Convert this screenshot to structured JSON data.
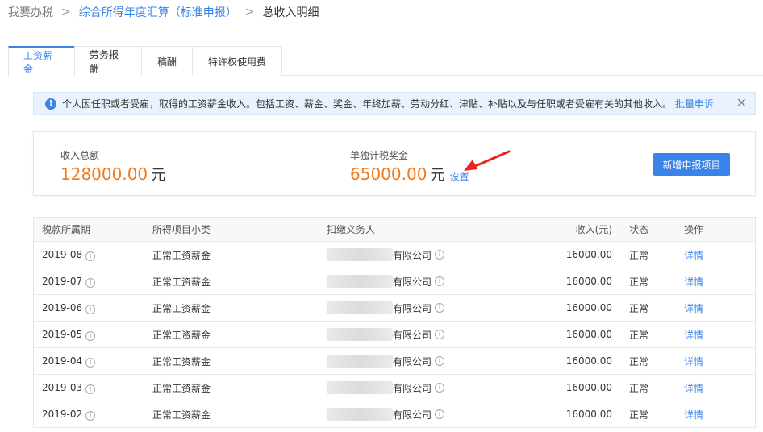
{
  "breadcrumb": {
    "root": "我要办税",
    "parent": "综合所得年度汇算（标准申报）",
    "current": "总收入明细"
  },
  "tabs": [
    "工资薪金",
    "劳务报酬",
    "稿酬",
    "特许权使用费"
  ],
  "notice": {
    "text": "个人因任职或者受雇，取得的工资薪金收入。包括工资、薪金、奖金、年终加薪、劳动分红、津贴、补贴以及与任职或者受雇有关的其他收入。",
    "link": "批量申诉"
  },
  "summary": {
    "total_label": "收入总额",
    "total_value": "128000.00",
    "unit": "元",
    "bonus_label": "单独计税奖金",
    "bonus_value": "65000.00",
    "set_link": "设置",
    "add_button": "新增申报项目"
  },
  "table": {
    "headers": [
      "税款所属期",
      "所得项目小类",
      "扣缴义务人",
      "收入(元)",
      "状态",
      "操作"
    ],
    "rows": [
      {
        "period": "2019-08",
        "type": "正常工资薪金",
        "payer": "有限公司",
        "income": "16000.00",
        "status": "正常",
        "action": "详情"
      },
      {
        "period": "2019-07",
        "type": "正常工资薪金",
        "payer": "有限公司",
        "income": "16000.00",
        "status": "正常",
        "action": "详情"
      },
      {
        "period": "2019-06",
        "type": "正常工资薪金",
        "payer": "有限公司",
        "income": "16000.00",
        "status": "正常",
        "action": "详情"
      },
      {
        "period": "2019-05",
        "type": "正常工资薪金",
        "payer": "有限公司",
        "income": "16000.00",
        "status": "正常",
        "action": "详情"
      },
      {
        "period": "2019-04",
        "type": "正常工资薪金",
        "payer": "有限公司",
        "income": "16000.00",
        "status": "正常",
        "action": "详情"
      },
      {
        "period": "2019-03",
        "type": "正常工资薪金",
        "payer": "有限公司",
        "income": "16000.00",
        "status": "正常",
        "action": "详情"
      },
      {
        "period": "2019-02",
        "type": "正常工资薪金",
        "payer": "有限公司",
        "income": "16000.00",
        "status": "正常",
        "action": "详情"
      }
    ]
  },
  "colors": {
    "accent": "#3a83e8",
    "amount": "#f07b1f",
    "arrow": "#e8231f"
  }
}
